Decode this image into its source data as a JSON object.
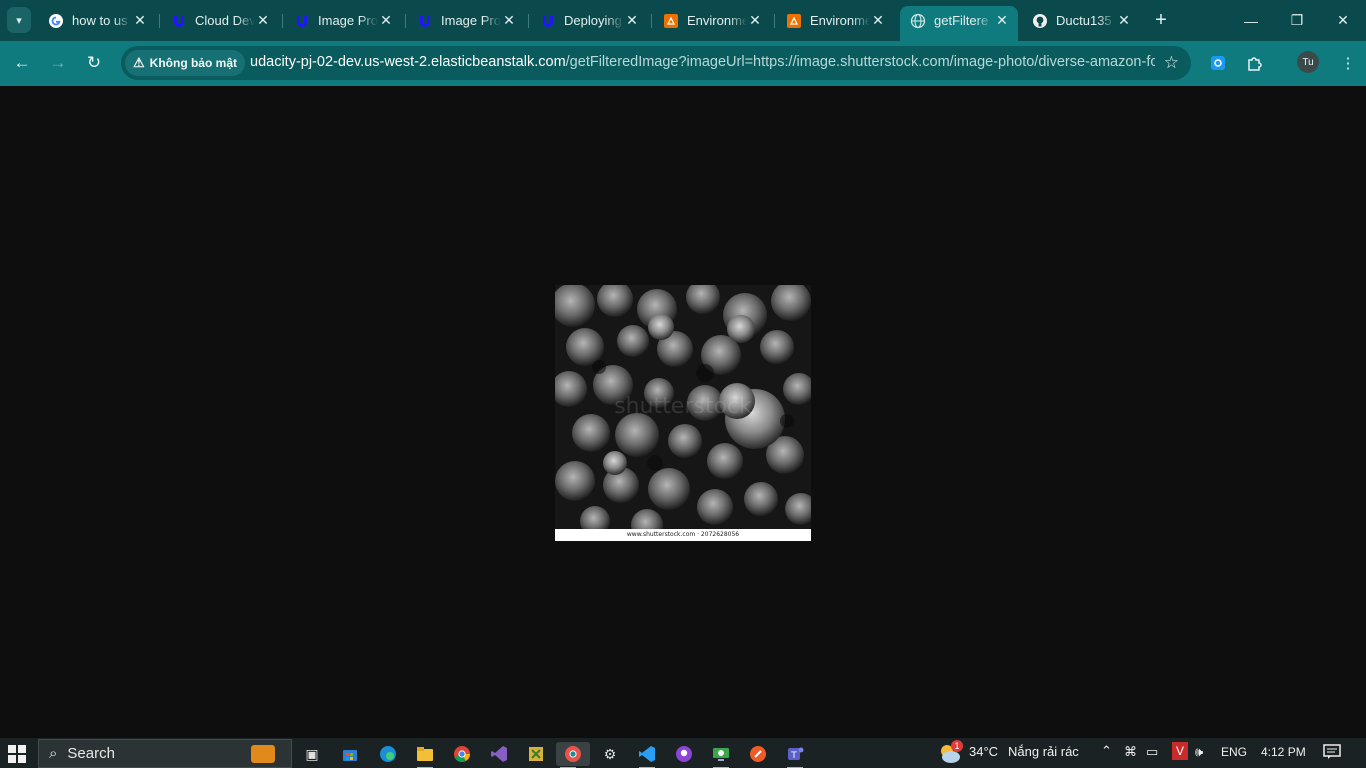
{
  "tabs": [
    {
      "title": "how to us",
      "icon": "google-icon",
      "active": false
    },
    {
      "title": "Cloud Dev",
      "icon": "udacity-icon",
      "active": false
    },
    {
      "title": "Image Pro",
      "icon": "udacity-icon",
      "active": false
    },
    {
      "title": "Image Pro",
      "icon": "udacity-icon",
      "active": false
    },
    {
      "title": "Deploying",
      "icon": "udacity-icon",
      "active": false
    },
    {
      "title": "Environme",
      "icon": "aws-beanstalk-icon",
      "active": false
    },
    {
      "title": "Environme",
      "icon": "aws-beanstalk-icon",
      "active": false
    },
    {
      "title": "getFiltere",
      "icon": "globe-icon",
      "active": true
    },
    {
      "title": "Ductu135",
      "icon": "github-icon",
      "active": false
    }
  ],
  "address": {
    "security_chip": "Không bảo mật",
    "host": "udacity-pj-02-dev.us-west-2.elasticbeanstalk.com",
    "path": "/getFilteredImage?imageUrl=https://image.shutterstock.com/image-photo/diverse-amazon-for..."
  },
  "profile_initials": "Tu",
  "page": {
    "image_caption": "www.shutterstock.com · 2072628056",
    "watermark": "shutterstock"
  },
  "taskbar": {
    "search_label": "Search",
    "weather_badge": "1",
    "temperature": "34°C",
    "weather_text": "Nắng rải rác",
    "language": "ENG",
    "time": "4:12 PM"
  },
  "colors": {
    "titlebar": "#0b4a4c",
    "toolbar": "#0f7b7f",
    "page_background": "#0e0e0e",
    "taskbar": "#1b2223"
  }
}
